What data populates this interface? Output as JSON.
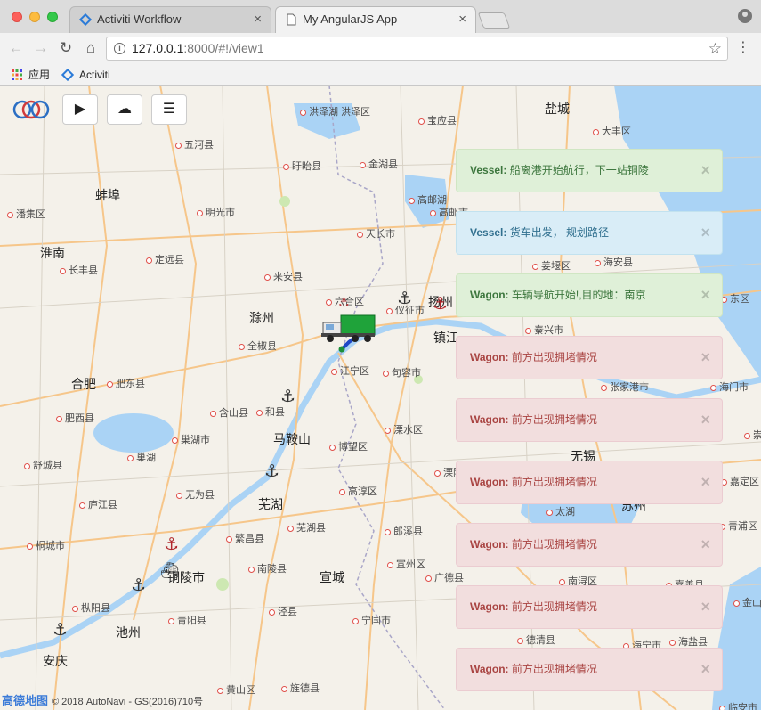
{
  "browser": {
    "tabs": [
      {
        "title": "Activiti Workflow",
        "active": false
      },
      {
        "title": "My AngularJS App",
        "active": true
      }
    ],
    "url_host": "127.0.0.1",
    "url_path": ":8000/#!/view1",
    "bookmarks": [
      {
        "label": "应用",
        "icon": "apps-grid-icon"
      },
      {
        "label": "Activiti",
        "icon": "activiti-diamond-icon"
      }
    ]
  },
  "app": {
    "controls": [
      {
        "name": "play-button",
        "icon": "play-icon",
        "glyph": "▶"
      },
      {
        "name": "deploy-button",
        "icon": "cloud-upload-icon",
        "glyph": "☁"
      },
      {
        "name": "menu-button",
        "icon": "list-icon",
        "glyph": "☰"
      }
    ]
  },
  "alerts": [
    {
      "type": "success",
      "source": "Vessel:",
      "message": " 船离港开始航行，下一站铜陵"
    },
    {
      "type": "info",
      "source": "Vessel:",
      "message": " 货车出发， 规划路径"
    },
    {
      "type": "success",
      "source": "Wagon:",
      "message": " 车辆导航开始!,目的地：南京"
    },
    {
      "type": "danger",
      "source": "Wagon:",
      "message": " 前方出现拥堵情况"
    },
    {
      "type": "danger",
      "source": "Wagon:",
      "message": " 前方出现拥堵情况"
    },
    {
      "type": "danger",
      "source": "Wagon:",
      "message": " 前方出现拥堵情况"
    },
    {
      "type": "danger",
      "source": "Wagon:",
      "message": " 前方出现拥堵情况"
    },
    {
      "type": "danger",
      "source": "Wagon:",
      "message": " 前方出现拥堵情况"
    },
    {
      "type": "danger",
      "source": "Wagon:",
      "message": " 前方出现拥堵情况"
    }
  ],
  "alert_close_glyph": "×",
  "map": {
    "cities": [
      {
        "name": "盐城",
        "major": true
      },
      {
        "name": "洪泽湖 洪泽区",
        "major": false
      },
      {
        "name": "宝应县",
        "major": false
      },
      {
        "name": "大丰区",
        "major": false
      },
      {
        "name": "五河县",
        "major": false
      },
      {
        "name": "盱眙县",
        "major": false
      },
      {
        "name": "金湖县",
        "major": false
      },
      {
        "name": "蚌埠",
        "major": true
      },
      {
        "name": "高邮湖",
        "major": false
      },
      {
        "name": "高邮市",
        "major": false
      },
      {
        "name": "潘集区",
        "major": false
      },
      {
        "name": "明光市",
        "major": false
      },
      {
        "name": "天长市",
        "major": false
      },
      {
        "name": "淮南",
        "major": true
      },
      {
        "name": "定远县",
        "major": false
      },
      {
        "name": "长丰县",
        "major": false
      },
      {
        "name": "来安县",
        "major": false
      },
      {
        "name": "姜堰区",
        "major": false
      },
      {
        "name": "海安县",
        "major": false
      },
      {
        "name": "六合区",
        "major": false
      },
      {
        "name": "仪征市",
        "major": false
      },
      {
        "name": "扬州",
        "major": true
      },
      {
        "name": "东区",
        "major": false
      },
      {
        "name": "滁州",
        "major": true
      },
      {
        "name": "镇江",
        "major": true
      },
      {
        "name": "秦兴市",
        "major": false
      },
      {
        "name": "全椒县",
        "major": false
      },
      {
        "name": "江宁区",
        "major": false
      },
      {
        "name": "句容市",
        "major": false
      },
      {
        "name": "合肥",
        "major": true
      },
      {
        "name": "肥东县",
        "major": false
      },
      {
        "name": "张家港市",
        "major": false
      },
      {
        "name": "海门市",
        "major": false
      },
      {
        "name": "含山县",
        "major": false
      },
      {
        "name": "和县",
        "major": false
      },
      {
        "name": "肥西县",
        "major": false
      },
      {
        "name": "溧水区",
        "major": false
      },
      {
        "name": "崇明",
        "major": false
      },
      {
        "name": "巢湖市",
        "major": false
      },
      {
        "name": "马鞍山",
        "major": true
      },
      {
        "name": "博望区",
        "major": false
      },
      {
        "name": "舒城县",
        "major": false
      },
      {
        "name": "巢湖",
        "major": false
      },
      {
        "name": "无锡",
        "major": true
      },
      {
        "name": "无为县",
        "major": false
      },
      {
        "name": "溧阳",
        "major": false
      },
      {
        "name": "嘉定区",
        "major": false
      },
      {
        "name": "高淳区",
        "major": false
      },
      {
        "name": "庐江县",
        "major": false
      },
      {
        "name": "芜湖",
        "major": true
      },
      {
        "name": "太湖",
        "major": false
      },
      {
        "name": "苏州",
        "major": true
      },
      {
        "name": "青浦区",
        "major": false
      },
      {
        "name": "桐城市",
        "major": false
      },
      {
        "name": "繁昌县",
        "major": false
      },
      {
        "name": "芜湖县",
        "major": false
      },
      {
        "name": "郎溪县",
        "major": false
      },
      {
        "name": "铜陵市",
        "major": true
      },
      {
        "name": "南陵县",
        "major": false
      },
      {
        "name": "宣城",
        "major": true
      },
      {
        "name": "宣州区",
        "major": false
      },
      {
        "name": "广德县",
        "major": false
      },
      {
        "name": "南浔区",
        "major": false
      },
      {
        "name": "嘉善县",
        "major": false
      },
      {
        "name": "金山区",
        "major": false
      },
      {
        "name": "枞阳县",
        "major": false
      },
      {
        "name": "池州",
        "major": true
      },
      {
        "name": "青阳县",
        "major": false
      },
      {
        "name": "泾县",
        "major": false
      },
      {
        "name": "宁国市",
        "major": false
      },
      {
        "name": "德清县",
        "major": false
      },
      {
        "name": "海宁市",
        "major": false
      },
      {
        "name": "海盐县",
        "major": false
      },
      {
        "name": "安庆",
        "major": true
      },
      {
        "name": "黄山区",
        "major": false
      },
      {
        "name": "旌德县",
        "major": false
      },
      {
        "name": "临安市",
        "major": false
      }
    ],
    "attribution_logo": "高德地图",
    "attribution_text": "© 2018 AutoNavi - GS(2016)710号"
  }
}
